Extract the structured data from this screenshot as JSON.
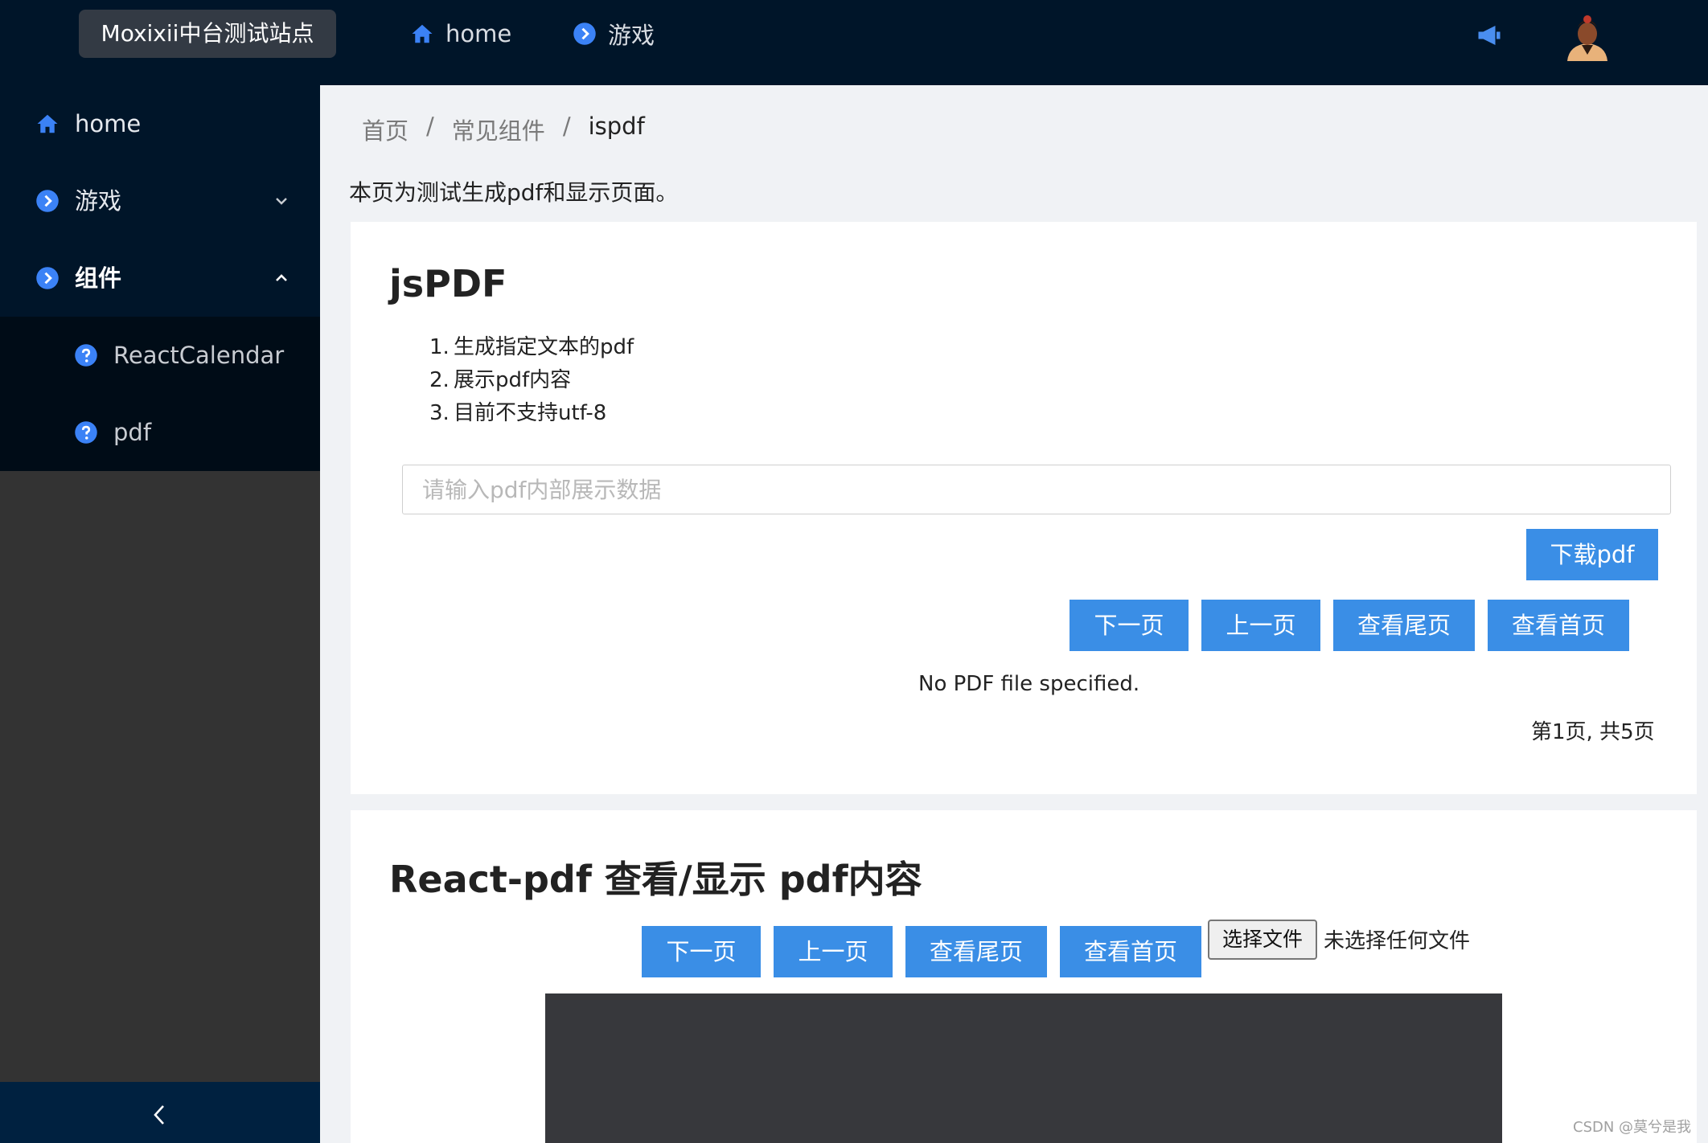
{
  "header": {
    "site_title": "Moxixii中台测试站点",
    "nav": [
      {
        "label": "home",
        "icon": "home-icon"
      },
      {
        "label": "游戏",
        "icon": "play-circle-icon"
      }
    ],
    "notification_icon": "megaphone-icon",
    "avatar_icon": "avatar-icon"
  },
  "sidebar": {
    "items": [
      {
        "label": "home",
        "icon": "home-icon"
      },
      {
        "label": "游戏",
        "icon": "play-circle-icon",
        "expand": "chevron-down-icon"
      },
      {
        "label": "组件",
        "icon": "play-circle-icon",
        "expand": "chevron-up-icon"
      }
    ],
    "subitems": [
      {
        "label": "ReactCalendar",
        "icon": "question-circle-icon"
      },
      {
        "label": "pdf",
        "icon": "question-circle-icon"
      }
    ],
    "collapse_icon": "chevron-left-icon"
  },
  "breadcrumb": {
    "items": [
      "首页",
      "常见组件",
      "ispdf"
    ],
    "separator": "/"
  },
  "intro": "本页为测试生成pdf和显示页面。",
  "jspdf": {
    "title": "jsPDF",
    "list": [
      {
        "num": "1.",
        "text": "生成指定文本的pdf"
      },
      {
        "num": "2.",
        "text": "展示pdf内容"
      },
      {
        "num": "3.",
        "text": "目前不支持utf-8"
      }
    ],
    "input_value": "",
    "input_placeholder": "请输入pdf内部展示数据",
    "download_label": "下载pdf",
    "nav_buttons": [
      "下一页",
      "上一页",
      "查看尾页",
      "查看首页"
    ],
    "no_file_text": "No PDF file specified.",
    "page_info": "第1页, 共5页"
  },
  "reactpdf": {
    "title": "React-pdf 查看/显示 pdf内容",
    "nav_buttons": [
      "下一页",
      "上一页",
      "查看尾页",
      "查看首页"
    ],
    "file_button": "选择文件",
    "file_status": "未选择任何文件"
  },
  "watermark": "CSDN @莫兮是我",
  "colors": {
    "header_bg": "#001529",
    "primary_button": "#3a8ee6",
    "page_bg": "#f0f2f5"
  }
}
